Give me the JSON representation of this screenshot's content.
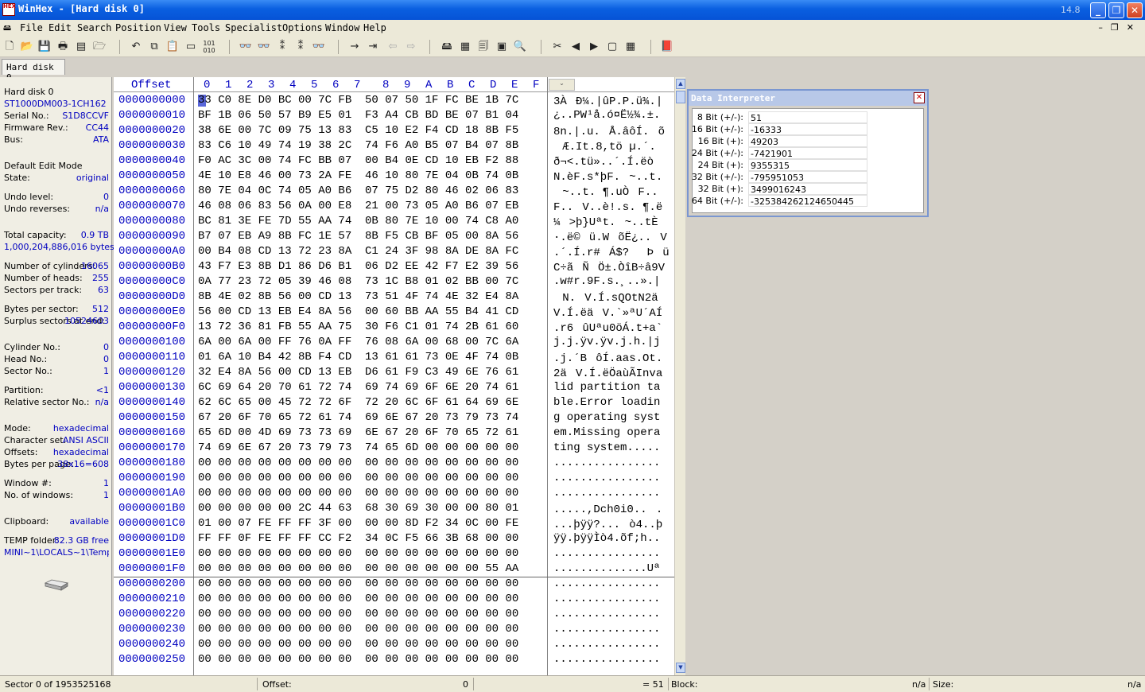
{
  "window": {
    "title": "WinHex - [Hard disk 0]",
    "version": "14.8",
    "icon_text": "HEX"
  },
  "menu": [
    "File",
    "Edit",
    "Search",
    "Position",
    "View",
    "Tools",
    "Specialist",
    "Options",
    "Window",
    "Help"
  ],
  "tab": "Hard disk 0",
  "info": {
    "name": "Hard disk 0",
    "model": "ST1000DM003-1CH162",
    "serial_label": "Serial No.:",
    "serial": "S1D8CCVF",
    "firmware_label": "Firmware Rev.:",
    "firmware": "CC44",
    "bus_label": "Bus:",
    "bus": "ATA",
    "edit_mode": "Default Edit Mode",
    "state_label": "State:",
    "state": "original",
    "undo_level_label": "Undo level:",
    "undo_level": "0",
    "undo_rev_label": "Undo reverses:",
    "undo_rev": "n/a",
    "capacity_label": "Total capacity:",
    "capacity": "0.9 TB",
    "capacity_bytes": "1,000,204,886,016 bytes",
    "cylinders_label": "Number of cylinders:",
    "cylinders": "16065",
    "heads_label": "Number of heads:",
    "heads": "255",
    "spt_label": "Sectors per track:",
    "spt": "63",
    "bps_label": "Bytes per sector:",
    "bps": "512",
    "surplus_label": "Surplus sectors at end:",
    "surplus": "10524603",
    "cyl_no_label": "Cylinder No.:",
    "cyl_no": "0",
    "head_no_label": "Head No.:",
    "head_no": "0",
    "sector_no_label": "Sector No.:",
    "sector_no": "1",
    "partition_label": "Partition:",
    "partition": "<1",
    "rel_sector_label": "Relative sector No.:",
    "rel_sector": "n/a",
    "mode_label": "Mode:",
    "mode": "hexadecimal",
    "charset_label": "Character set:",
    "charset": "ANSI ASCII",
    "offsets_label": "Offsets:",
    "offsets": "hexadecimal",
    "bpp_label": "Bytes per page:",
    "bpp": "38x16=608",
    "window_no_label": "Window #:",
    "window_no": "1",
    "windows_label": "No. of windows:",
    "windows": "1",
    "clipboard_label": "Clipboard:",
    "clipboard": "available",
    "temp_label": "TEMP folder:",
    "temp": "82.3 GB free",
    "temp_path": "MINI~1\\LOCALS~1\\Temp"
  },
  "hex_header": {
    "offset": "Offset",
    "cols": [
      "0",
      "1",
      "2",
      "3",
      "4",
      "5",
      "6",
      "7",
      "8",
      "9",
      "A",
      "B",
      "C",
      "D",
      "E",
      "F"
    ]
  },
  "rows": [
    {
      "off": "0000000000",
      "hex": "33 C0 8E D0 BC 00 7C FB  50 07 50 1F FC BE 1B 7C",
      "asc": "3ÀÐ¼.|ûP.P.ü¾.|"
    },
    {
      "off": "0000000010",
      "hex": "BF 1B 06 50 57 B9 E5 01  F3 A4 CB BD BE 07 B1 04",
      "asc": "¿..PW¹å.ó¤Ë½¾.±."
    },
    {
      "off": "0000000020",
      "hex": "38 6E 00 7C 09 75 13 83  C5 10 E2 F4 CD 18 8B F5",
      "asc": "8n.|.u.Å.âôÍ.õ"
    },
    {
      "off": "0000000030",
      "hex": "83 C6 10 49 74 19 38 2C  74 F6 A0 B5 07 B4 07 8B",
      "asc": "Æ.It.8,tö µ.´."
    },
    {
      "off": "0000000040",
      "hex": "F0 AC 3C 00 74 FC BB 07  00 B4 0E CD 10 EB F2 88",
      "asc": "ð¬<.tü»..´.Í.ëò"
    },
    {
      "off": "0000000050",
      "hex": "4E 10 E8 46 00 73 2A FE  46 10 80 7E 04 0B 74 0B",
      "asc": "N.èF.s*þF.~..t."
    },
    {
      "off": "0000000060",
      "hex": "80 7E 04 0C 74 05 A0 B6  07 75 D2 80 46 02 06 83",
      "asc": "~..t. ¶.uÒF.."
    },
    {
      "off": "0000000070",
      "hex": "46 08 06 83 56 0A 00 E8  21 00 73 05 A0 B6 07 EB",
      "asc": "F..V..è!.s. ¶.ë"
    },
    {
      "off": "0000000080",
      "hex": "BC 81 3E FE 7D 55 AA 74  0B 80 7E 10 00 74 C8 A0",
      "asc": "¼>þ}Uªt.~..tÈ "
    },
    {
      "off": "0000000090",
      "hex": "B7 07 EB A9 8B FC 1E 57  8B F5 CB BF 05 00 8A 56",
      "asc": "·.ë©ü.WõË¿..V"
    },
    {
      "off": "00000000A0",
      "hex": "00 B4 08 CD 13 72 23 8A  C1 24 3F 98 8A DE 8A FC",
      "asc": ".´.Í.r#Á$?Þü"
    },
    {
      "off": "00000000B0",
      "hex": "43 F7 E3 8B D1 86 D6 B1  06 D2 EE 42 F7 E2 39 56",
      "asc": "C÷ãÑÖ±.ÒîB÷â9V"
    },
    {
      "off": "00000000C0",
      "hex": "0A 77 23 72 05 39 46 08  73 1C B8 01 02 BB 00 7C",
      "asc": ".w#r.9F.s.¸..».|"
    },
    {
      "off": "00000000D0",
      "hex": "8B 4E 02 8B 56 00 CD 13  73 51 4F 74 4E 32 E4 8A",
      "asc": "N.V.Í.sQOtN2ä"
    },
    {
      "off": "00000000E0",
      "hex": "56 00 CD 13 EB E4 8A 56  00 60 BB AA 55 B4 41 CD",
      "asc": "V.Í.ëäV.`»ªU´AÍ"
    },
    {
      "off": "00000000F0",
      "hex": "13 72 36 81 FB 55 AA 75  30 F6 C1 01 74 2B 61 60",
      "asc": ".r6ûUªu0öÁ.t+a`"
    },
    {
      "off": "0000000100",
      "hex": "6A 00 6A 00 FF 76 0A FF  76 08 6A 00 68 00 7C 6A",
      "asc": "j.j.ÿv.ÿv.j.h.|j"
    },
    {
      "off": "0000000110",
      "hex": "01 6A 10 B4 42 8B F4 CD  13 61 61 73 0E 4F 74 0B",
      "asc": ".j.´BôÍ.aas.Ot."
    },
    {
      "off": "0000000120",
      "hex": "32 E4 8A 56 00 CD 13 EB  D6 61 F9 C3 49 6E 76 61",
      "asc": "2äV.Í.ëÖaùÃInva"
    },
    {
      "off": "0000000130",
      "hex": "6C 69 64 20 70 61 72 74  69 74 69 6F 6E 20 74 61",
      "asc": "lid partition ta"
    },
    {
      "off": "0000000140",
      "hex": "62 6C 65 00 45 72 72 6F  72 20 6C 6F 61 64 69 6E",
      "asc": "ble.Error loadin"
    },
    {
      "off": "0000000150",
      "hex": "67 20 6F 70 65 72 61 74  69 6E 67 20 73 79 73 74",
      "asc": "g operating syst"
    },
    {
      "off": "0000000160",
      "hex": "65 6D 00 4D 69 73 73 69  6E 67 20 6F 70 65 72 61",
      "asc": "em.Missing opera"
    },
    {
      "off": "0000000170",
      "hex": "74 69 6E 67 20 73 79 73  74 65 6D 00 00 00 00 00",
      "asc": "ting system....."
    },
    {
      "off": "0000000180",
      "hex": "00 00 00 00 00 00 00 00  00 00 00 00 00 00 00 00",
      "asc": "................"
    },
    {
      "off": "0000000190",
      "hex": "00 00 00 00 00 00 00 00  00 00 00 00 00 00 00 00",
      "asc": "................"
    },
    {
      "off": "00000001A0",
      "hex": "00 00 00 00 00 00 00 00  00 00 00 00 00 00 00 00",
      "asc": "................"
    },
    {
      "off": "00000001B0",
      "hex": "00 00 00 00 00 2C 44 63  68 30 69 30 00 00 80 01",
      "asc": ".....,Dch0i0..."
    },
    {
      "off": "00000001C0",
      "hex": "01 00 07 FE FF FF 3F 00  00 00 8D F2 34 0C 00 FE",
      "asc": "...þÿÿ?...ò4..þ"
    },
    {
      "off": "00000001D0",
      "hex": "FF FF 0F FE FF FF CC F2  34 0C F5 66 3B 68 00 00",
      "asc": "ÿÿ.þÿÿÌò4.õf;h.."
    },
    {
      "off": "00000001E0",
      "hex": "00 00 00 00 00 00 00 00  00 00 00 00 00 00 00 00",
      "asc": "................"
    },
    {
      "off": "00000001F0",
      "hex": "00 00 00 00 00 00 00 00  00 00 00 00 00 00 55 AA",
      "asc": "..............Uª"
    },
    {
      "off": "0000000200",
      "hex": "00 00 00 00 00 00 00 00  00 00 00 00 00 00 00 00",
      "asc": "................"
    },
    {
      "off": "0000000210",
      "hex": "00 00 00 00 00 00 00 00  00 00 00 00 00 00 00 00",
      "asc": "................"
    },
    {
      "off": "0000000220",
      "hex": "00 00 00 00 00 00 00 00  00 00 00 00 00 00 00 00",
      "asc": "................"
    },
    {
      "off": "0000000230",
      "hex": "00 00 00 00 00 00 00 00  00 00 00 00 00 00 00 00",
      "asc": "................"
    },
    {
      "off": "0000000240",
      "hex": "00 00 00 00 00 00 00 00  00 00 00 00 00 00 00 00",
      "asc": "................"
    },
    {
      "off": "0000000250",
      "hex": "00 00 00 00 00 00 00 00  00 00 00 00 00 00 00 00",
      "asc": "................"
    }
  ],
  "interpreter": {
    "title": "Data Interpreter",
    "rows": [
      {
        "label": "8 Bit (+/-):",
        "value": "51"
      },
      {
        "label": "16 Bit (+/-):",
        "value": "-16333"
      },
      {
        "label": "16 Bit (+):",
        "value": "49203"
      },
      {
        "label": "24 Bit (+/-):",
        "value": "-7421901"
      },
      {
        "label": "24 Bit (+):",
        "value": "9355315"
      },
      {
        "label": "32 Bit (+/-):",
        "value": "-795951053"
      },
      {
        "label": "32 Bit (+):",
        "value": "3499016243"
      },
      {
        "label": "64 Bit (+/-):",
        "value": "-325384262124650445"
      }
    ]
  },
  "status": {
    "sector": "Sector 0 of 1953525168",
    "offset_label": "Offset:",
    "offset": "0",
    "value": "= 51",
    "block_label": "Block:",
    "block": "n/a",
    "size_label": "Size:",
    "size": "n/a"
  }
}
